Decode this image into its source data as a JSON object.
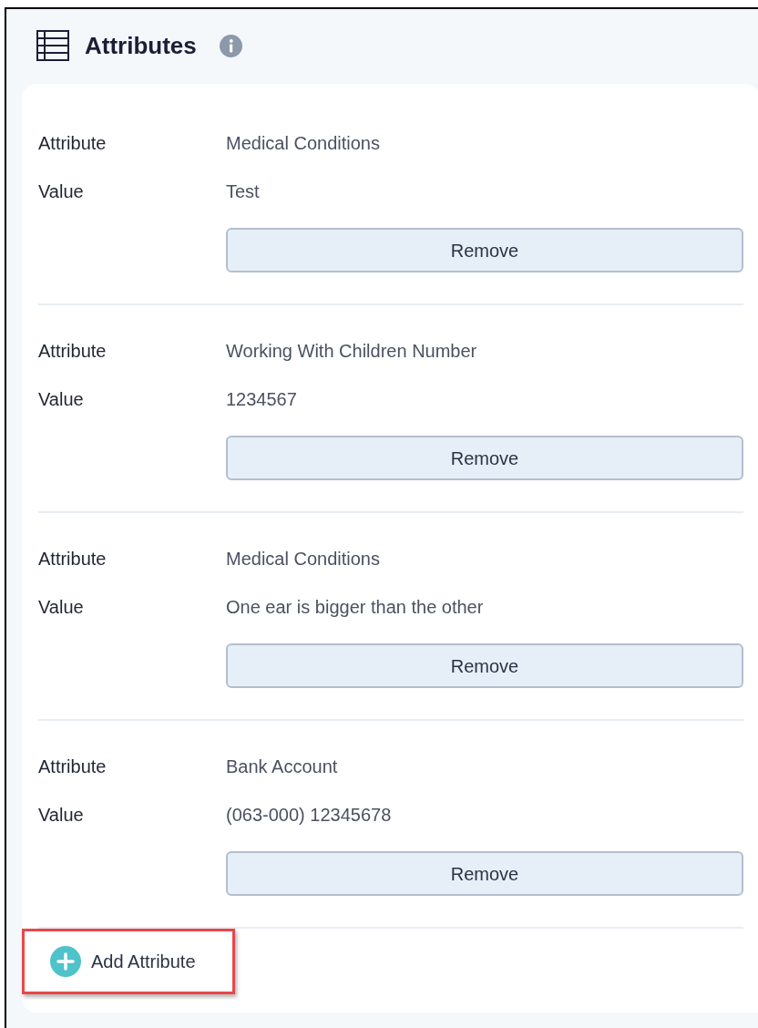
{
  "header": {
    "title": "Attributes"
  },
  "attributes": [
    {
      "label_attribute": "Attribute",
      "attribute": "Medical Conditions",
      "label_value": "Value",
      "value": "Test",
      "button": "Remove"
    },
    {
      "label_attribute": "Attribute",
      "attribute": "Working With Children Number",
      "label_value": "Value",
      "value": "1234567",
      "button": "Remove"
    },
    {
      "label_attribute": "Attribute",
      "attribute": "Medical Conditions",
      "label_value": "Value",
      "value": "One ear is bigger than the other",
      "button": "Remove"
    },
    {
      "label_attribute": "Attribute",
      "attribute": "Bank Account",
      "label_value": "Value",
      "value": "(063-000) 12345678",
      "button": "Remove"
    }
  ],
  "add_button": {
    "label": "Add Attribute",
    "highlighted": true
  }
}
